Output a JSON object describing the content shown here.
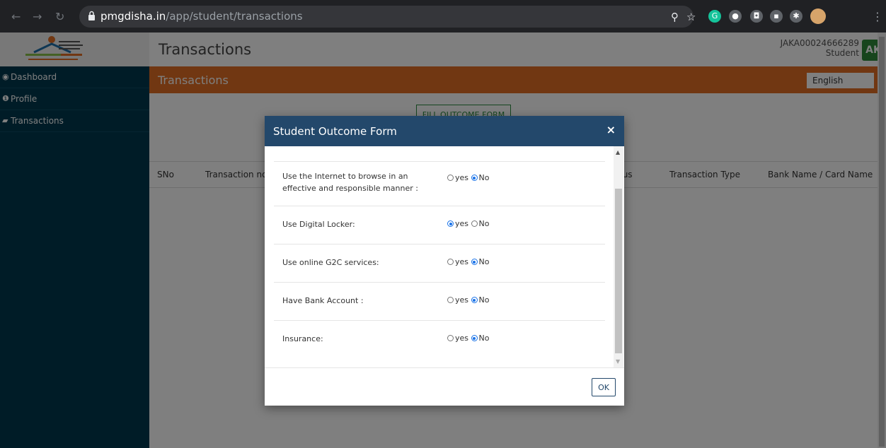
{
  "browser": {
    "domain": "pmgdisha.in",
    "path": "/app/student/transactions"
  },
  "sidebar": {
    "items": [
      {
        "label": "Dashboard"
      },
      {
        "label": "Profile"
      },
      {
        "label": "Transactions"
      }
    ]
  },
  "header": {
    "title": "Transactions",
    "user_id": "JAKA00024666289",
    "role": "Student",
    "avatar": "AK"
  },
  "section": {
    "title": "Transactions",
    "language": "English"
  },
  "main": {
    "fill_button": "FILL OUTCOME FORM",
    "columns": [
      "SNo",
      "Transaction no.",
      "tus",
      "Transaction Type",
      "Bank Name / Card Name"
    ]
  },
  "modal": {
    "title": "Student Outcome Form",
    "close": "×",
    "ok_label": "OK",
    "yes_label": "yes",
    "no_label": "No",
    "questions": [
      {
        "text": "Use the Internet to browse in an effective and responsible manner :",
        "selected": "No"
      },
      {
        "text": "Use Digital Locker:",
        "selected": "yes"
      },
      {
        "text": "Use online G2C services:",
        "selected": "No"
      },
      {
        "text": "Have Bank Account :",
        "selected": "No"
      },
      {
        "text": "Insurance:",
        "selected": "No"
      }
    ]
  },
  "colors": {
    "sidebar": "#00394f",
    "orange_bar": "#e36f24",
    "modal_header": "#23486b",
    "avatar": "#2e8b3a"
  }
}
